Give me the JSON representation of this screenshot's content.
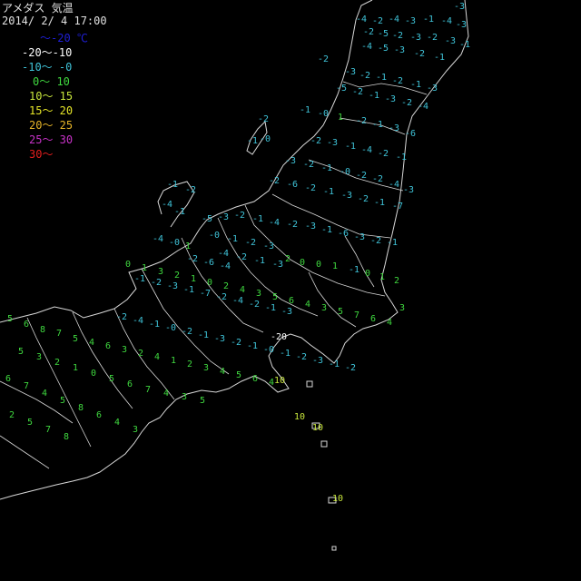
{
  "header": {
    "title": "アメダス 気温",
    "datetime": "2014/ 2/ 4 17:00"
  },
  "legend": [
    {
      "label": "〜-20 ℃",
      "color": "#1f1fd8",
      "indent": 44
    },
    {
      "label": "-20〜-10",
      "color": "#ffffff",
      "indent": 24
    },
    {
      "label": "-10〜 -0",
      "color": "#3fc3d8",
      "indent": 24
    },
    {
      "label": "0〜 10",
      "color": "#3fd83f",
      "indent": 36
    },
    {
      "label": "10〜 15",
      "color": "#c8e63c",
      "indent": 32
    },
    {
      "label": "15〜 20",
      "color": "#e6e628",
      "indent": 32
    },
    {
      "label": "20〜 25",
      "color": "#e6b428",
      "indent": 32
    },
    {
      "label": "25〜 30",
      "color": "#c832c8",
      "indent": 32
    },
    {
      "label": "30〜",
      "color": "#e61e1e",
      "indent": 32
    }
  ],
  "colors": {
    "coast": "#d8d8d8",
    "cold": "#3fc3d8",
    "mild": "#3fd83f",
    "warm": "#c8e63c",
    "very_cold": "#ffffff"
  },
  "stations": [
    {
      "v": "-3",
      "c": "cold"
    },
    {
      "v": "-4",
      "c": "cold"
    },
    {
      "v": "-2",
      "c": "cold"
    },
    {
      "v": "-4",
      "c": "cold"
    },
    {
      "v": "-3",
      "c": "cold"
    },
    {
      "v": "-1",
      "c": "cold"
    },
    {
      "v": "-4",
      "c": "cold"
    },
    {
      "v": "-3",
      "c": "cold"
    },
    {
      "v": "-2",
      "c": "cold"
    },
    {
      "v": "-5",
      "c": "cold"
    },
    {
      "v": "-2",
      "c": "cold"
    },
    {
      "v": "-3",
      "c": "cold"
    },
    {
      "v": "-2",
      "c": "cold"
    },
    {
      "v": "-3",
      "c": "cold"
    },
    {
      "v": "-1",
      "c": "cold"
    },
    {
      "v": "-4",
      "c": "cold"
    },
    {
      "v": "-5",
      "c": "cold"
    },
    {
      "v": "-3",
      "c": "cold"
    },
    {
      "v": "-2",
      "c": "cold"
    },
    {
      "v": "-1",
      "c": "cold"
    },
    {
      "v": "-2",
      "c": "cold"
    },
    {
      "v": "-3",
      "c": "cold"
    },
    {
      "v": "-2",
      "c": "cold"
    },
    {
      "v": "-1",
      "c": "cold"
    },
    {
      "v": "-2",
      "c": "cold"
    },
    {
      "v": "-1",
      "c": "cold"
    },
    {
      "v": "-3",
      "c": "cold"
    },
    {
      "v": "-5",
      "c": "cold"
    },
    {
      "v": "-2",
      "c": "cold"
    },
    {
      "v": "-1",
      "c": "cold"
    },
    {
      "v": "-3",
      "c": "cold"
    },
    {
      "v": "-2",
      "c": "cold"
    },
    {
      "v": "-4",
      "c": "cold"
    },
    {
      "v": "-1",
      "c": "cold"
    },
    {
      "v": "-0",
      "c": "cold"
    },
    {
      "v": "1",
      "c": "mild"
    },
    {
      "v": "-2",
      "c": "cold"
    },
    {
      "v": "-1",
      "c": "cold"
    },
    {
      "v": "-3",
      "c": "cold"
    },
    {
      "v": "-6",
      "c": "cold"
    },
    {
      "v": "-2",
      "c": "cold"
    },
    {
      "v": "-1",
      "c": "cold"
    },
    {
      "v": "-0",
      "c": "cold"
    },
    {
      "v": "-2",
      "c": "cold"
    },
    {
      "v": "-3",
      "c": "cold"
    },
    {
      "v": "-1",
      "c": "cold"
    },
    {
      "v": "-4",
      "c": "cold"
    },
    {
      "v": "-2",
      "c": "cold"
    },
    {
      "v": "-1",
      "c": "cold"
    },
    {
      "v": "-3",
      "c": "cold"
    },
    {
      "v": "-2",
      "c": "cold"
    },
    {
      "v": "-1",
      "c": "cold"
    },
    {
      "v": "-0",
      "c": "cold"
    },
    {
      "v": "-2",
      "c": "cold"
    },
    {
      "v": "-2",
      "c": "cold"
    },
    {
      "v": "-4",
      "c": "cold"
    },
    {
      "v": "-3",
      "c": "cold"
    },
    {
      "v": "-2",
      "c": "cold"
    },
    {
      "v": "-6",
      "c": "cold"
    },
    {
      "v": "-2",
      "c": "cold"
    },
    {
      "v": "-1",
      "c": "cold"
    },
    {
      "v": "-3",
      "c": "cold"
    },
    {
      "v": "-2",
      "c": "cold"
    },
    {
      "v": "-1",
      "c": "cold"
    },
    {
      "v": "-7",
      "c": "cold"
    },
    {
      "v": "-1",
      "c": "cold"
    },
    {
      "v": "-2",
      "c": "cold"
    },
    {
      "v": "-4",
      "c": "cold"
    },
    {
      "v": "-1",
      "c": "cold"
    },
    {
      "v": "-5",
      "c": "cold"
    },
    {
      "v": "-3",
      "c": "cold"
    },
    {
      "v": "-2",
      "c": "cold"
    },
    {
      "v": "-1",
      "c": "cold"
    },
    {
      "v": "-4",
      "c": "cold"
    },
    {
      "v": "-2",
      "c": "cold"
    },
    {
      "v": "-3",
      "c": "cold"
    },
    {
      "v": "-1",
      "c": "cold"
    },
    {
      "v": "-6",
      "c": "cold"
    },
    {
      "v": "-3",
      "c": "cold"
    },
    {
      "v": "-2",
      "c": "cold"
    },
    {
      "v": "-1",
      "c": "cold"
    },
    {
      "v": "-4",
      "c": "cold"
    },
    {
      "v": "-0",
      "c": "cold"
    },
    {
      "v": "1",
      "c": "mild"
    },
    {
      "v": "2",
      "c": "mild"
    },
    {
      "v": "0",
      "c": "mild"
    },
    {
      "v": "0",
      "c": "mild"
    },
    {
      "v": "1",
      "c": "mild"
    },
    {
      "v": "-1",
      "c": "cold"
    },
    {
      "v": "0",
      "c": "mild"
    },
    {
      "v": "1",
      "c": "mild"
    },
    {
      "v": "2",
      "c": "mild"
    },
    {
      "v": "0",
      "c": "mild"
    },
    {
      "v": "1",
      "c": "mild"
    },
    {
      "v": "3",
      "c": "mild"
    },
    {
      "v": "2",
      "c": "mild"
    },
    {
      "v": "1",
      "c": "mild"
    },
    {
      "v": "0",
      "c": "mild"
    },
    {
      "v": "2",
      "c": "mild"
    },
    {
      "v": "4",
      "c": "mild"
    },
    {
      "v": "3",
      "c": "mild"
    },
    {
      "v": "5",
      "c": "mild"
    },
    {
      "v": "6",
      "c": "mild"
    },
    {
      "v": "4",
      "c": "mild"
    },
    {
      "v": "3",
      "c": "mild"
    },
    {
      "v": "5",
      "c": "mild"
    },
    {
      "v": "7",
      "c": "mild"
    },
    {
      "v": "6",
      "c": "mild"
    },
    {
      "v": "4",
      "c": "mild"
    },
    {
      "v": "3",
      "c": "mild"
    },
    {
      "v": "5",
      "c": "mild"
    },
    {
      "v": "6",
      "c": "mild"
    },
    {
      "v": "8",
      "c": "mild"
    },
    {
      "v": "7",
      "c": "mild"
    },
    {
      "v": "5",
      "c": "mild"
    },
    {
      "v": "4",
      "c": "mild"
    },
    {
      "v": "6",
      "c": "mild"
    },
    {
      "v": "3",
      "c": "mild"
    },
    {
      "v": "2",
      "c": "mild"
    },
    {
      "v": "4",
      "c": "mild"
    },
    {
      "v": "1",
      "c": "mild"
    },
    {
      "v": "2",
      "c": "mild"
    },
    {
      "v": "3",
      "c": "mild"
    },
    {
      "v": "4",
      "c": "mild"
    },
    {
      "v": "5",
      "c": "mild"
    },
    {
      "v": "6",
      "c": "mild"
    },
    {
      "v": "4",
      "c": "mild"
    },
    {
      "v": "5",
      "c": "mild"
    },
    {
      "v": "3",
      "c": "mild"
    },
    {
      "v": "2",
      "c": "mild"
    },
    {
      "v": "1",
      "c": "mild"
    },
    {
      "v": "0",
      "c": "mild"
    },
    {
      "v": "5",
      "c": "mild"
    },
    {
      "v": "6",
      "c": "mild"
    },
    {
      "v": "7",
      "c": "mild"
    },
    {
      "v": "4",
      "c": "mild"
    },
    {
      "v": "3",
      "c": "mild"
    },
    {
      "v": "5",
      "c": "mild"
    },
    {
      "v": "6",
      "c": "mild"
    },
    {
      "v": "7",
      "c": "mild"
    },
    {
      "v": "4",
      "c": "mild"
    },
    {
      "v": "5",
      "c": "mild"
    },
    {
      "v": "8",
      "c": "mild"
    },
    {
      "v": "6",
      "c": "mild"
    },
    {
      "v": "4",
      "c": "mild"
    },
    {
      "v": "3",
      "c": "mild"
    },
    {
      "v": "2",
      "c": "mild"
    },
    {
      "v": "5",
      "c": "mild"
    },
    {
      "v": "7",
      "c": "mild"
    },
    {
      "v": "8",
      "c": "mild"
    },
    {
      "v": "-0",
      "c": "cold"
    },
    {
      "v": "-1",
      "c": "cold"
    },
    {
      "v": "-2",
      "c": "cold"
    },
    {
      "v": "-3",
      "c": "cold"
    },
    {
      "v": "-4",
      "c": "cold"
    },
    {
      "v": "-2",
      "c": "cold"
    },
    {
      "v": "-1",
      "c": "cold"
    },
    {
      "v": "-3",
      "c": "cold"
    },
    {
      "v": "-2",
      "c": "cold"
    },
    {
      "v": "-6",
      "c": "cold"
    },
    {
      "v": "-4",
      "c": "cold"
    },
    {
      "v": "-1",
      "c": "cold"
    },
    {
      "v": "-2",
      "c": "cold"
    },
    {
      "v": "-3",
      "c": "cold"
    },
    {
      "v": "-1",
      "c": "cold"
    },
    {
      "v": "-7",
      "c": "cold"
    },
    {
      "v": "-2",
      "c": "cold"
    },
    {
      "v": "-4",
      "c": "cold"
    },
    {
      "v": "-2",
      "c": "cold"
    },
    {
      "v": "-1",
      "c": "cold"
    },
    {
      "v": "-3",
      "c": "cold"
    },
    {
      "v": "-2",
      "c": "cold"
    },
    {
      "v": "-4",
      "c": "cold"
    },
    {
      "v": "-1",
      "c": "cold"
    },
    {
      "v": "-0",
      "c": "cold"
    },
    {
      "v": "-2",
      "c": "cold"
    },
    {
      "v": "-1",
      "c": "cold"
    },
    {
      "v": "-3",
      "c": "cold"
    },
    {
      "v": "-2",
      "c": "cold"
    },
    {
      "v": "-1",
      "c": "cold"
    },
    {
      "v": "-0",
      "c": "cold"
    },
    {
      "v": "-1",
      "c": "cold"
    },
    {
      "v": "-2",
      "c": "cold"
    },
    {
      "v": "-3",
      "c": "cold"
    },
    {
      "v": "-1",
      "c": "cold"
    },
    {
      "v": "-2",
      "c": "cold"
    },
    {
      "v": "-20",
      "c": "very_cold"
    },
    {
      "v": "10",
      "c": "warm"
    },
    {
      "v": "10",
      "c": "warm"
    },
    {
      "v": "10",
      "c": "warm"
    },
    {
      "v": "10",
      "c": "warm"
    }
  ]
}
